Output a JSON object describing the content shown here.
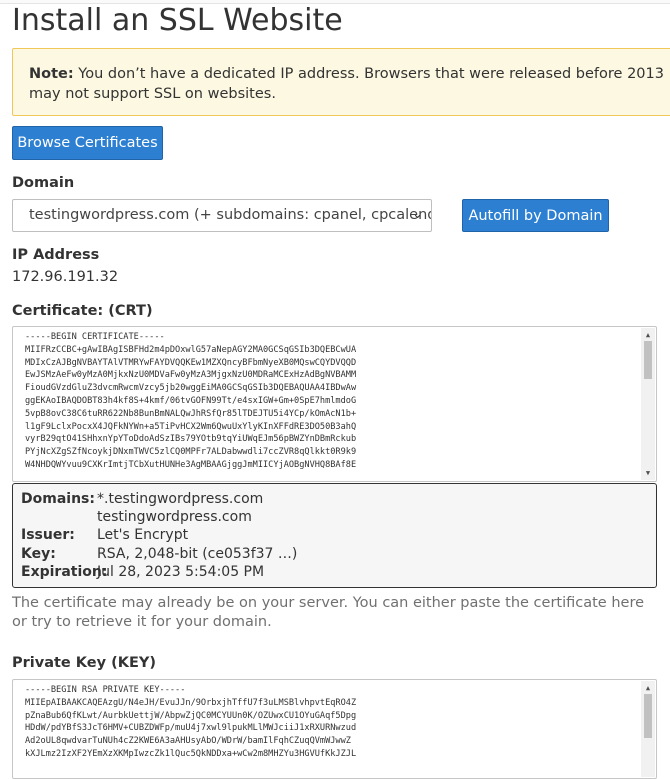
{
  "page": {
    "title": "Install an SSL Website"
  },
  "note": {
    "label": "Note:",
    "text": " You don’t have a dedicated IP address. Browsers that were released before 2013 may not support SSL on websites.",
    "continuation": "websites."
  },
  "buttons": {
    "browse": "Browse Certificates",
    "autofill": "Autofill by Domain"
  },
  "domain": {
    "label": "Domain",
    "selected": "testingwordpress.com    (+ subdomains: cpanel, cpcalendars, cpcontacts, mail, webdisk, webmail, www)"
  },
  "ip": {
    "label": "IP Address",
    "value": "172.96.191.32"
  },
  "certificate": {
    "label": "Certificate: (CRT)",
    "lines": [
      "-----BEGIN CERTIFICATE-----",
      "MIIFRzCCBC+gAwIBAgISBFHd2m4pDOxwlG57aNepAGY2MA0GCSqGSIb3DQEBCwUA",
      "MDIxCzAJBgNVBAYTAlVTMRYwFAYDVQQKEw1MZXQncyBFbmNyeXB0MQswCQYDVQQD",
      "EwJSMzAeFw0yMzA0MjkxNzU0MDVaFw0yMzA3MjgxNzU0MDRaMCExHzAdBgNVBAMM",
      "FioudGVzdGluZ3dvcmRwcmVzcy5jb20wggEiMA0GCSqGSIb3DQEBAQUAA4IBDwAw",
      "ggEKAoIBAQDOBT83h4kf8S+4kmf/06tvGOFN99Tt/e4sxIGW+Gm+0SpE7hmlmdoG",
      "5vpB8ovC38C6tuRR622Nb8BunBmNALQwJhRSfQr85lTDEJTU5i4YCp/kOmAcN1b+",
      "l1gF9LclxPocxX4JQFkNYWn+a5TiPvHCX2Wm6QwuUxYlyKInXFFdRE3DO50B3ahQ",
      "vyrB29qtO41SHhxnYpYToDdoAdSzIBs79YOtb9tqYiUWqEJm56pBWZYnDBmRckub",
      "PYjNcXZgSZfNcoykjDNxmTWVC5zlCQ0MPFr7ALDabwwdli7ccZVR8qQlkkt0R9k9",
      "W4NHDQWYvuu9CXKrImtjTCbXutHUNHe3AgMBAAGjggJmMIICYjAOBgNVHQ8BAf8E"
    ]
  },
  "cert_info": {
    "domains_label": "Domains:",
    "domain1": "*.testingwordpress.com",
    "domain2": "testingwordpress.com",
    "issuer_label": "Issuer:",
    "issuer": "Let's Encrypt",
    "key_label": "Key:",
    "key": "RSA, 2,048-bit (ce053f37 …)",
    "expiration_label": "Expiration:",
    "expiration": "Jul 28, 2023 5:54:05 PM"
  },
  "help_text": "The certificate may already be on your server. You can either paste the certificate here or try to retrieve it for your domain.",
  "private_key": {
    "label": "Private Key (KEY)",
    "lines": [
      "-----BEGIN RSA PRIVATE KEY-----",
      "MIIEpAIBAAKCAQEAzgU/N4eJH/EvuJJn/9OrbxjhTffU7f3uLMSBlvhpvtEqRO4Z",
      "pZnaBub6QfKLwt/AurbkUettjW/AbpwZjQC0MCYUUn0K/OZUwxCU1OYuGAqf5Dpg",
      "HDdW/pdYBfS3JcT6HMV+CUBZDWFp/muU4j7xwl9lpukMLlMWJciiJ1xRXURNwzud",
      "Ad2oUL8qwdvarTuNUh4cZ2KWE6A3aAHUsyAbO/WDrW/bamIlFqhCZuqQVmWJwwZ",
      "kXJLmz2IzXF2YEmXzXKMpIwzcZk1lQuc5QkNDDxa+wCw2m8MHZYu3HGVUfKkJZJL"
    ]
  }
}
